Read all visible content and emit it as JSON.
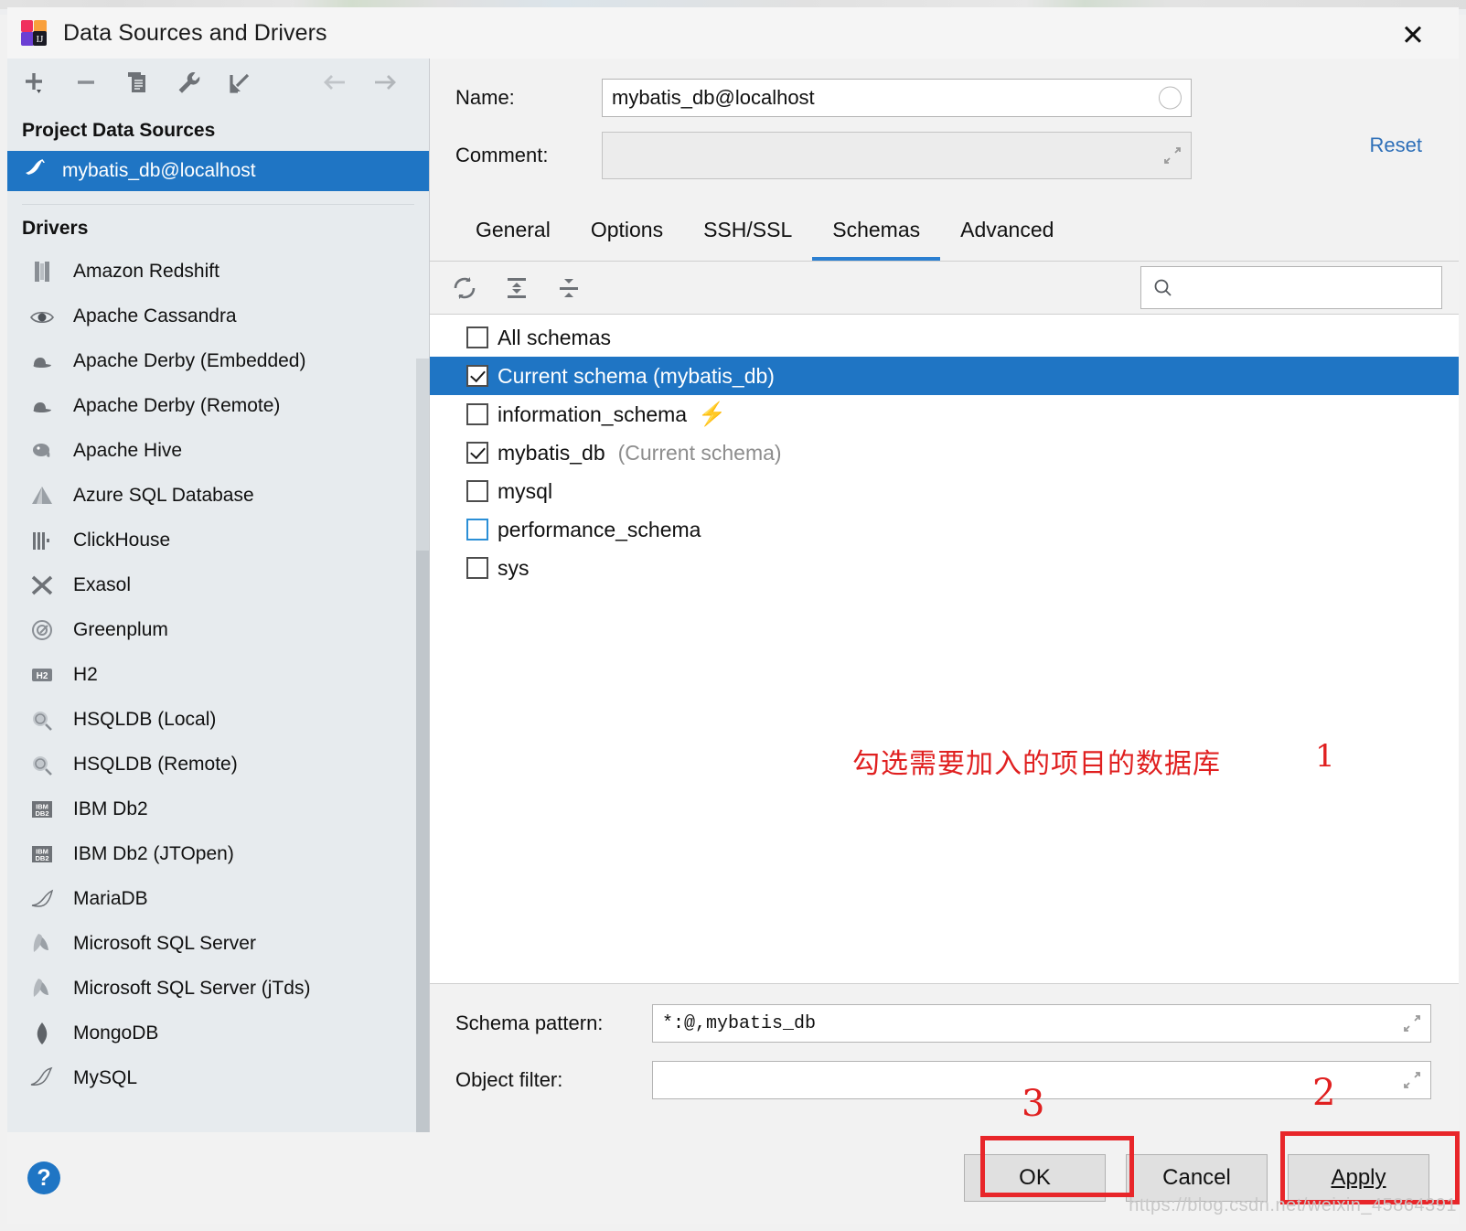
{
  "window": {
    "title": "Data Sources and Drivers",
    "app_icon": "intellij-idea-icon",
    "close_label": "✕"
  },
  "left_pane": {
    "toolbar": [
      {
        "name": "add-button",
        "glyph": "+"
      },
      {
        "name": "remove-button",
        "glyph": "−"
      },
      {
        "name": "copy-button",
        "glyph": "copy"
      },
      {
        "name": "properties-button",
        "glyph": "wrench"
      },
      {
        "name": "import-button",
        "glyph": "import-arrow"
      },
      {
        "name": "back-button",
        "glyph": "←"
      },
      {
        "name": "forward-button",
        "glyph": "→"
      }
    ],
    "project_data_sources_header": "Project Data Sources",
    "data_sources": [
      {
        "label": "mybatis_db@localhost",
        "icon": "mysql-dolphin-icon",
        "selected": true
      }
    ],
    "drivers_header": "Drivers",
    "drivers": [
      {
        "label": "Amazon Redshift",
        "icon": "redshift-icon"
      },
      {
        "label": "Apache Cassandra",
        "icon": "cassandra-eye-icon"
      },
      {
        "label": "Apache Derby (Embedded)",
        "icon": "derby-hat-icon"
      },
      {
        "label": "Apache Derby (Remote)",
        "icon": "derby-hat-icon"
      },
      {
        "label": "Apache Hive",
        "icon": "hive-elephant-icon"
      },
      {
        "label": "Azure SQL Database",
        "icon": "azure-icon"
      },
      {
        "label": "ClickHouse",
        "icon": "clickhouse-icon"
      },
      {
        "label": "Exasol",
        "icon": "exasol-x-icon"
      },
      {
        "label": "Greenplum",
        "icon": "greenplum-icon"
      },
      {
        "label": "H2",
        "icon": "h2-icon"
      },
      {
        "label": "HSQLDB (Local)",
        "icon": "hsqldb-icon"
      },
      {
        "label": "HSQLDB (Remote)",
        "icon": "hsqldb-icon"
      },
      {
        "label": "IBM Db2",
        "icon": "ibm-db2-icon"
      },
      {
        "label": "IBM Db2 (JTOpen)",
        "icon": "ibm-db2-icon"
      },
      {
        "label": "MariaDB",
        "icon": "mariadb-seal-icon"
      },
      {
        "label": "Microsoft SQL Server",
        "icon": "mssql-icon"
      },
      {
        "label": "Microsoft SQL Server (jTds)",
        "icon": "mssql-icon"
      },
      {
        "label": "MongoDB",
        "icon": "mongodb-leaf-icon"
      },
      {
        "label": "MySQL",
        "icon": "mysql-dolphin-icon"
      }
    ]
  },
  "form": {
    "name_label": "Name:",
    "name_value": "mybatis_db@localhost",
    "comment_label": "Comment:",
    "comment_value": "",
    "reset_label": "Reset"
  },
  "tabs": [
    {
      "label": "General",
      "active": false
    },
    {
      "label": "Options",
      "active": false
    },
    {
      "label": "SSH/SSL",
      "active": false
    },
    {
      "label": "Schemas",
      "active": true
    },
    {
      "label": "Advanced",
      "active": false
    }
  ],
  "schema_toolbar": {
    "refresh_label": "refresh-icon",
    "expand_label": "expand-all-icon",
    "collapse_label": "collapse-all-icon",
    "search_placeholder": "",
    "search_value": ""
  },
  "schemas": [
    {
      "label": "All schemas",
      "checked": false,
      "selected": false,
      "sub": "",
      "bolt": false,
      "focused": false
    },
    {
      "label": "Current schema (mybatis_db)",
      "checked": true,
      "selected": true,
      "sub": "",
      "bolt": false,
      "focused": false
    },
    {
      "label": "information_schema",
      "checked": false,
      "selected": false,
      "sub": "",
      "bolt": true,
      "focused": false
    },
    {
      "label": "mybatis_db",
      "checked": true,
      "selected": false,
      "sub": "(Current schema)",
      "bolt": false,
      "focused": false
    },
    {
      "label": "mysql",
      "checked": false,
      "selected": false,
      "sub": "",
      "bolt": false,
      "focused": false
    },
    {
      "label": "performance_schema",
      "checked": false,
      "selected": false,
      "sub": "",
      "bolt": false,
      "focused": true
    },
    {
      "label": "sys",
      "checked": false,
      "selected": false,
      "sub": "",
      "bolt": false,
      "focused": false
    }
  ],
  "filters": {
    "schema_pattern_label": "Schema pattern:",
    "schema_pattern_value": "*:@,mybatis_db",
    "object_filter_label": "Object filter:",
    "object_filter_value": ""
  },
  "footer": {
    "help_label": "?",
    "ok_label": "OK",
    "cancel_label": "Cancel",
    "apply_label": "Apply"
  },
  "annotations": {
    "schema_note": "勾选需要加入的项目的数据库",
    "num_1": "1",
    "num_2": "2",
    "num_3": "3",
    "watermark": "https://blog.csdn.net/weixin_45864391",
    "highlight_color": "#e8262a",
    "note_color": "#e02020"
  }
}
